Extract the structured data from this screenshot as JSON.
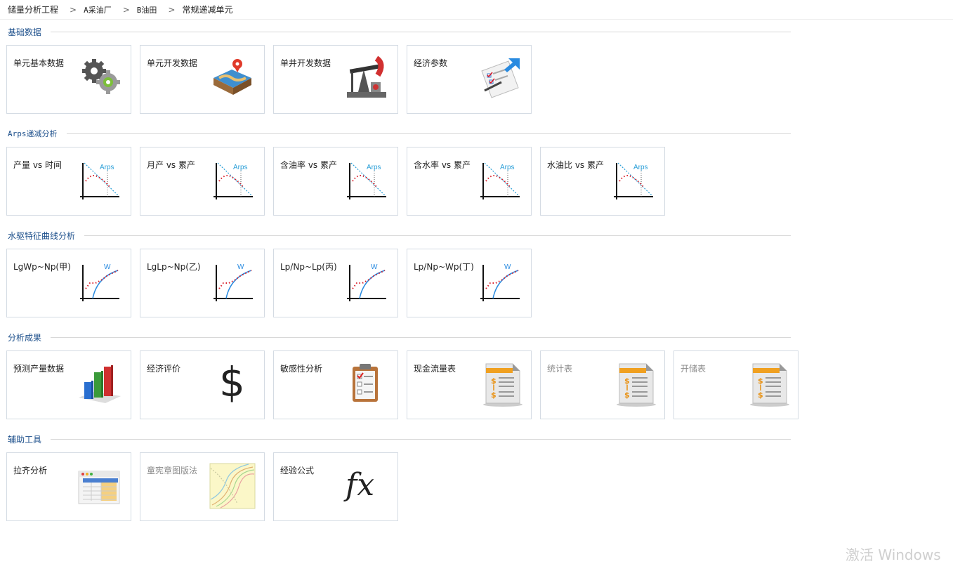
{
  "breadcrumb": [
    "储量分析工程",
    "A采油厂",
    "B油田",
    "常规递减单元"
  ],
  "sections": {
    "basic": {
      "title": "基础数据",
      "tiles": [
        "单元基本数据",
        "单元开发数据",
        "单井开发数据",
        "经济参数"
      ]
    },
    "arps": {
      "title": "Arps递减分析",
      "chart_label": "Arps",
      "tiles": [
        "产量 vs 时间",
        "月产 vs 累产",
        "含油率 vs 累产",
        "含水率 vs 累产",
        "水油比 vs 累产"
      ]
    },
    "water": {
      "title": "水驱特征曲线分析",
      "chart_label": "W",
      "tiles": [
        "LgWp~Np(甲)",
        "LgLp~Np(乙)",
        "Lp/Np~Lp(丙)",
        "Lp/Np~Wp(丁)"
      ]
    },
    "results": {
      "title": "分析成果",
      "dollar": "$",
      "tiles": [
        "预测产量数据",
        "经济评价",
        "敏感性分析",
        "现金流量表",
        "统计表",
        "开储表"
      ]
    },
    "tools": {
      "title": "辅助工具",
      "fx": "fx",
      "tiles": [
        "拉齐分析",
        "童宪章图版法",
        "经验公式"
      ]
    }
  },
  "watermark": "激活 Windows",
  "colors": {
    "section_title": "#1c4f8b",
    "tile_border": "#d4dbe3",
    "disabled_text": "#8a8a8a",
    "arps_line": "#2a9fd8",
    "curve_points": "#d81e2a"
  }
}
